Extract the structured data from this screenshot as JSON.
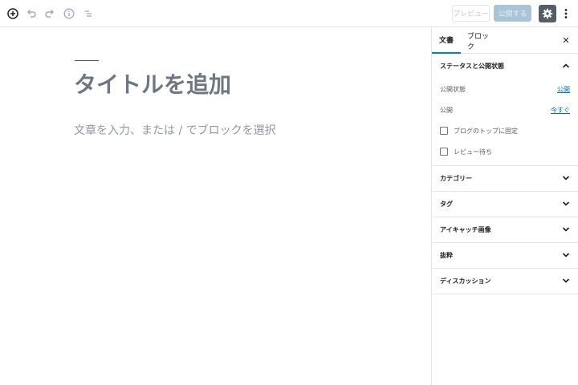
{
  "toolbar": {
    "icons": [
      "add-block-icon",
      "undo-icon",
      "redo-icon",
      "info-icon",
      "block-navigation-icon"
    ],
    "preview_label": "プレビュー",
    "publish_label": "公開する",
    "settings_icon": "gear-icon",
    "more_icon": "vertical-ellipsis-icon"
  },
  "editor": {
    "title_placeholder": "タイトルを追加",
    "block_placeholder": "文章を入力、または / でブロックを選択"
  },
  "sidebar": {
    "tabs": [
      {
        "label": "文書",
        "active": true
      },
      {
        "label": "ブロック",
        "active": false
      }
    ],
    "close_icon": "close-icon",
    "status_panel": {
      "title": "ステータスと公開状態",
      "visibility_label": "公開状態",
      "visibility_value": "公開",
      "publish_label": "公開",
      "publish_value": "今すぐ",
      "sticky_label": "ブログのトップに固定",
      "pending_label": "レビュー待ち"
    },
    "panels": [
      {
        "title": "カテゴリー"
      },
      {
        "title": "タグ"
      },
      {
        "title": "アイキャッチ画像"
      },
      {
        "title": "抜粋"
      },
      {
        "title": "ディスカッション"
      }
    ]
  },
  "colors": {
    "accent": "#0085ba",
    "link": "#0073aa",
    "settings_bg": "#555d66",
    "publish_disabled": "#a8c4d6"
  }
}
